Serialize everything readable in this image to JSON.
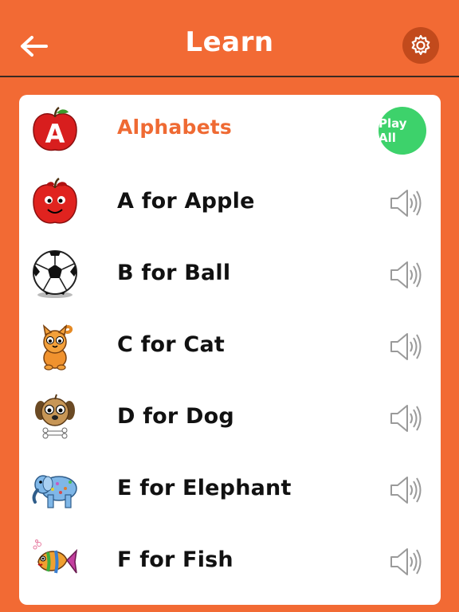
{
  "header": {
    "title": "Learn",
    "back_icon": "back-arrow-icon",
    "settings_icon": "gear-icon"
  },
  "list": {
    "heading": "Alphabets",
    "heading_icon": "apple-letter-a-icon",
    "play_all_label": "Play All",
    "items": [
      {
        "label": "A for Apple",
        "icon": "apple-icon"
      },
      {
        "label": "B for Ball",
        "icon": "soccer-ball-icon"
      },
      {
        "label": "C for Cat",
        "icon": "cat-icon"
      },
      {
        "label": "D for Dog",
        "icon": "dog-icon"
      },
      {
        "label": "E for Elephant",
        "icon": "elephant-icon"
      },
      {
        "label": "F for Fish",
        "icon": "fish-icon"
      }
    ]
  },
  "colors": {
    "background": "#f26a34",
    "accent_text": "#ef6a33",
    "play_all": "#3dd26b"
  }
}
